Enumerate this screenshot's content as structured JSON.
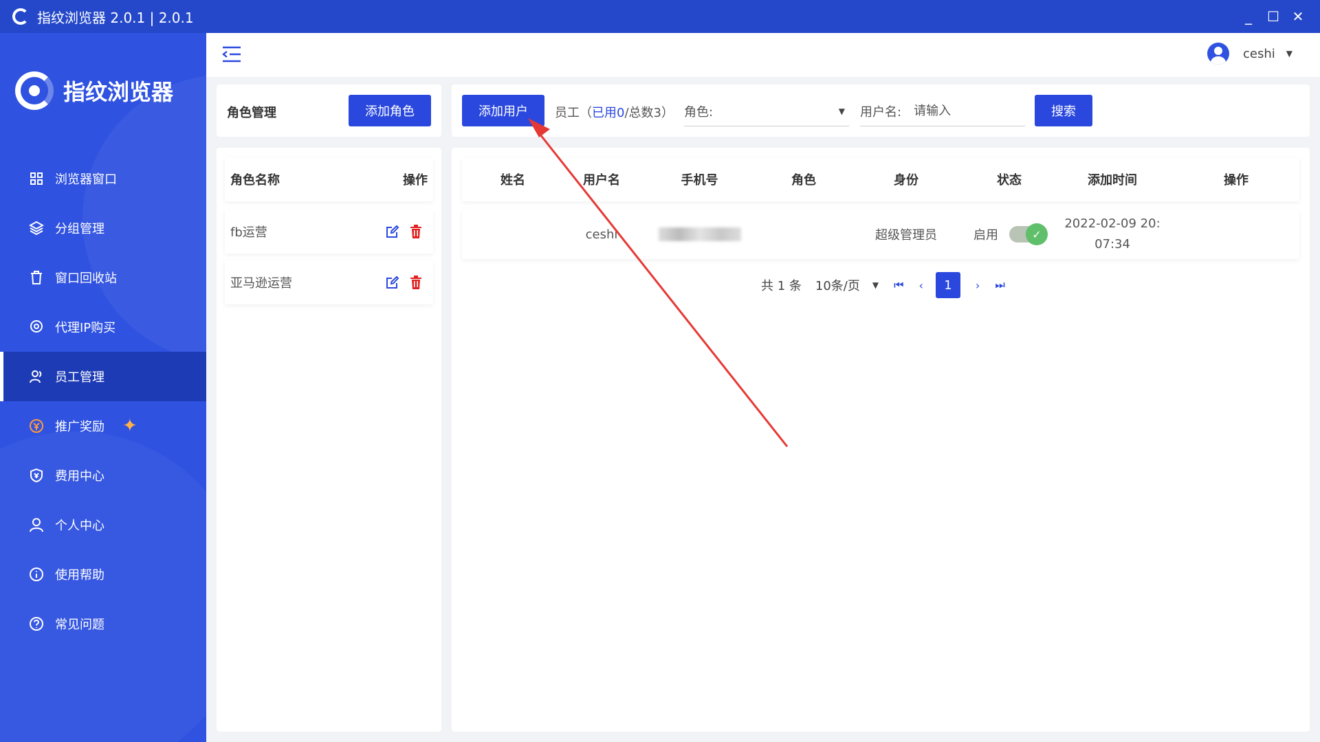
{
  "window": {
    "title": "指纹浏览器 2.0.1 | 2.0.1",
    "controls": {
      "minimize": "_",
      "maximize": "☐",
      "close": "✕"
    }
  },
  "brand": {
    "name": "指纹浏览器"
  },
  "nav": {
    "items": [
      {
        "label": "浏览器窗口",
        "icon": "grid-icon"
      },
      {
        "label": "分组管理",
        "icon": "layers-icon"
      },
      {
        "label": "窗口回收站",
        "icon": "trash-icon"
      },
      {
        "label": "代理IP购买",
        "icon": "location-icon"
      },
      {
        "label": "员工管理",
        "icon": "users-icon",
        "active": true
      },
      {
        "label": "推广奖励",
        "icon": "coin-icon"
      },
      {
        "label": "费用中心",
        "icon": "shield-yen-icon"
      },
      {
        "label": "个人中心",
        "icon": "person-icon"
      },
      {
        "label": "使用帮助",
        "icon": "info-icon"
      },
      {
        "label": "常见问题",
        "icon": "question-icon"
      }
    ]
  },
  "header": {
    "username": "ceshi"
  },
  "roles": {
    "title": "角色管理",
    "add_button": "添加角色",
    "columns": {
      "name": "角色名称",
      "action": "操作"
    },
    "items": [
      {
        "name": "fb运营"
      },
      {
        "name": "亚马逊运营"
      }
    ]
  },
  "filters": {
    "add_user_button": "添加用户",
    "employee_prefix": "员工（",
    "used_label": "已用0",
    "total_label": "/总数3）",
    "role_label": "角色:",
    "username_label": "用户名:",
    "username_placeholder": "请输入",
    "search_button": "搜索"
  },
  "table": {
    "columns": [
      "姓名",
      "用户名",
      "手机号",
      "角色",
      "身份",
      "状态",
      "添加时间",
      "操作"
    ],
    "rows": [
      {
        "name": "",
        "username": "ceshi",
        "phone": "",
        "role": "",
        "identity": "超级管理员",
        "status": "启用",
        "status_on": true,
        "time_line1": "2022-02-09 20:",
        "time_line2": "07:34",
        "action": ""
      }
    ]
  },
  "pager": {
    "total": "共 1 条",
    "page_size": "10条/页",
    "current": "1"
  },
  "colors": {
    "titlebar": "#2448c9",
    "sidebar": "#2f52e0",
    "sidebar_active": "#1d3bb5",
    "primary": "#2a48de",
    "toggle_on": "#5fbf6a",
    "delete": "#e02020",
    "annotation_arrow": "#e53935"
  }
}
